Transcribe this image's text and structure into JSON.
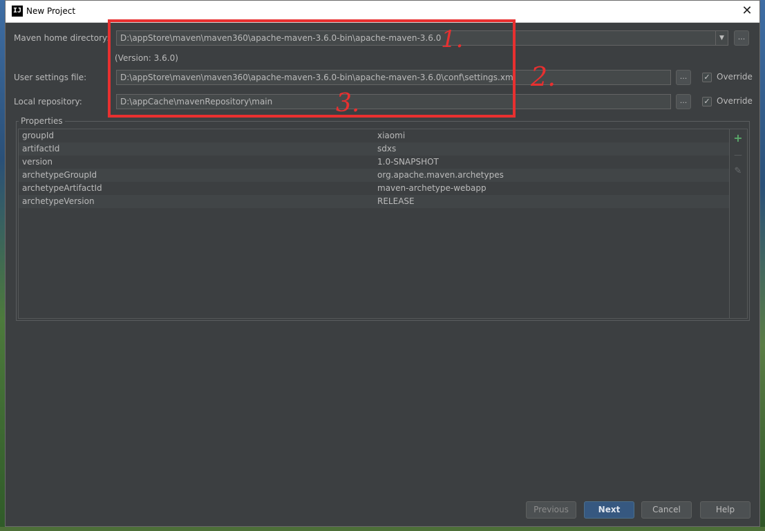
{
  "window": {
    "title": "New Project",
    "close_glyph": "✕"
  },
  "maven": {
    "home_label": "Maven home directory:",
    "home_value": "D:\\appStore\\maven\\maven360\\apache-maven-3.6.0-bin\\apache-maven-3.6.0",
    "version_text": "(Version: 3.6.0)",
    "settings_label": "User settings file:",
    "settings_value": "D:\\appStore\\maven\\maven360\\apache-maven-3.6.0-bin\\apache-maven-3.6.0\\conf\\settings.xml",
    "repo_label": "Local repository:",
    "repo_value": "D:\\appCache\\mavenRepository\\main",
    "browse_label": "...",
    "dropdown_glyph": "▼",
    "override_label": "Override",
    "settings_override_checked": true,
    "repo_override_checked": true
  },
  "properties": {
    "legend": "Properties",
    "rows": [
      {
        "key": "groupId",
        "value": "xiaomi"
      },
      {
        "key": "artifactId",
        "value": "sdxs"
      },
      {
        "key": "version",
        "value": "1.0-SNAPSHOT"
      },
      {
        "key": "archetypeGroupId",
        "value": "org.apache.maven.archetypes"
      },
      {
        "key": "archetypeArtifactId",
        "value": "maven-archetype-webapp"
      },
      {
        "key": "archetypeVersion",
        "value": "RELEASE"
      }
    ],
    "tools": {
      "add_glyph": "+",
      "remove_glyph": "—",
      "edit_glyph": "✎"
    }
  },
  "footer": {
    "previous_label": "Previous",
    "next_label": "Next",
    "cancel_label": "Cancel",
    "help_label": "Help"
  },
  "annotations": {
    "one": "1.",
    "two": "2.",
    "three": "3.",
    "color": "#e83030"
  },
  "colors": {
    "dialog_bg": "#3c3f41",
    "primary_button": "#365880",
    "add_icon": "#59a869"
  },
  "icons": [
    "app-icon",
    "close-icon",
    "dropdown-arrow-icon",
    "checkbox-check-icon",
    "add-icon",
    "remove-icon",
    "edit-icon"
  ]
}
